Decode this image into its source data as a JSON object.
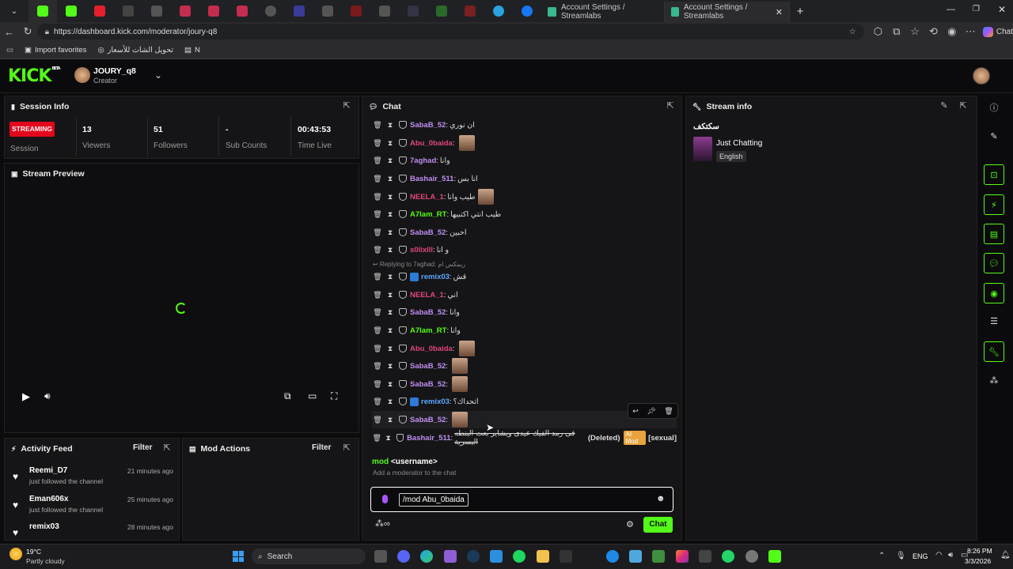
{
  "browser": {
    "tabs": [
      {
        "title": "Account Settings / Streamlabs",
        "active": false
      },
      {
        "title": "Account Settings / Streamlabs",
        "active": true
      }
    ],
    "url": "https://dashboard.kick.com/moderator/joury-q8",
    "profile_label": "Chat",
    "favorites": [
      "Import favorites",
      "تحويل الشات للأسعار",
      "N"
    ]
  },
  "header": {
    "logo": "KICK",
    "logo_tag": "BETA",
    "channel_name": "JOURY_q8",
    "channel_role": "Creator"
  },
  "session": {
    "title": "Session Info",
    "status_badge": "STREAMING",
    "status_label": "Session",
    "viewers": "13",
    "viewers_label": "Viewers",
    "followers": "51",
    "followers_label": "Followers",
    "subs": "-",
    "subs_label": "Sub Counts",
    "time_live": "00:43:53",
    "time_live_label": "Time Live"
  },
  "preview": {
    "title": "Stream Preview"
  },
  "activity": {
    "title": "Activity Feed",
    "filter": "Filter",
    "items": [
      {
        "name": "Reemi_D7",
        "action": "just followed the channel",
        "time": "21 minutes ago"
      },
      {
        "name": "Eman606x",
        "action": "just followed the channel",
        "time": "25 minutes ago"
      },
      {
        "name": "remix03",
        "action": "",
        "time": "28 minutes ago"
      }
    ]
  },
  "mod_actions": {
    "title": "Mod Actions",
    "filter": "Filter"
  },
  "chat": {
    "title": "Chat",
    "messages": [
      {
        "user": "SabaB_52",
        "color": "#c08ef0",
        "text": "ان نوري"
      },
      {
        "user": "Abu_0baida",
        "color": "#e0467a",
        "text": ""
      },
      {
        "user": "7aghad",
        "color": "#c08ef0",
        "text": "وانا"
      },
      {
        "user": "Bashair_511",
        "color": "#c08ef0",
        "text": "انا بس"
      },
      {
        "user": "NEELA_1",
        "color": "#e0467a",
        "text": "طيب وانا"
      },
      {
        "user": "A7lam_RT",
        "color": "#53fc18",
        "text": "طيب انتي اكتبيها"
      },
      {
        "user": "SabaB_52",
        "color": "#c08ef0",
        "text": "احبين"
      },
      {
        "user": "s0lixlll",
        "color": "#e0467a",
        "text": "و انا"
      },
      {
        "user": "remix03",
        "color": "#5aa8ff",
        "text": "قش"
      },
      {
        "user": "NEELA_1",
        "color": "#e0467a",
        "text": "اني"
      },
      {
        "user": "SabaB_52",
        "color": "#c08ef0",
        "text": "وانا"
      },
      {
        "user": "A7lam_RT",
        "color": "#53fc18",
        "text": "وانا"
      },
      {
        "user": "Abu_0baida",
        "color": "#e0467a",
        "text": ""
      },
      {
        "user": "SabaB_52",
        "color": "#c08ef0",
        "text": ""
      },
      {
        "user": "SabaB_52",
        "color": "#c08ef0",
        "text": ""
      },
      {
        "user": "remix03",
        "color": "#5aa8ff",
        "text": "اتحداك؟"
      },
      {
        "user": "SabaB_52",
        "color": "#c08ef0",
        "text": ""
      },
      {
        "user": "Bashair_511",
        "color": "#c08ef0",
        "text": "فى رمد الفيك عيدى ويشاير بعت البنطه البسرية"
      }
    ],
    "reply_context": "Replying to 7aghad: ريمكس ام",
    "deleted_tag": "(Deleted)",
    "ai_mod_tag": "AI Mod",
    "ai_reason": "[sexual]",
    "suggest_cmd": "mod",
    "suggest_arg": "<username>",
    "suggest_desc": "Add a moderator to the chat",
    "input_value": "/mod Abu_0baida",
    "send_label": "Chat"
  },
  "stream_info": {
    "title": "Stream info",
    "stream_title": "سكتكف",
    "category": "Just Chatting",
    "language": "English"
  },
  "taskbar": {
    "weather_temp": "19°C",
    "weather_desc": "Partly cloudy",
    "search_label": "Search",
    "lang": "ENG",
    "time": "8:26 PM",
    "date": "3/3/2026"
  },
  "colors": {
    "kick_green": "#53fc18",
    "streaming_red": "#e3061c",
    "ai_mod_orange": "#e8a33c"
  }
}
